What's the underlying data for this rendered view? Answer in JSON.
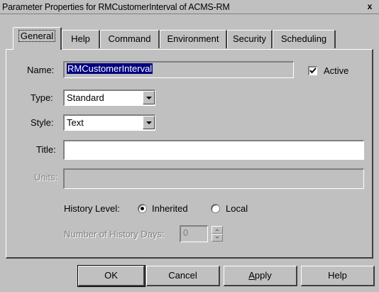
{
  "window": {
    "title": "Parameter Properties for RMCustomerInterval of ACMS-RM",
    "close_label": "x"
  },
  "tabs": [
    {
      "label": "General",
      "active": true
    },
    {
      "label": "Help"
    },
    {
      "label": "Command"
    },
    {
      "label": "Environment"
    },
    {
      "label": "Security"
    },
    {
      "label": "Scheduling"
    }
  ],
  "form": {
    "name_label": "Name:",
    "name_value": "RMCustomerInterval",
    "active_label": "Active",
    "active_checked": true,
    "type_label": "Type:",
    "type_value": "Standard",
    "style_label": "Style:",
    "style_value": "Text",
    "title_label": "Title:",
    "title_value": "",
    "units_label": "Units:",
    "units_value": "",
    "history_level_label": "History Level:",
    "history_options": [
      {
        "label": "Inherited",
        "selected": true
      },
      {
        "label": "Local",
        "selected": false
      }
    ],
    "history_days_label": "Number of History Days:",
    "history_days_value": "0"
  },
  "buttons": {
    "ok": "OK",
    "cancel": "Cancel",
    "apply_prefix": "A",
    "apply_rest": "pply",
    "help": "Help"
  }
}
